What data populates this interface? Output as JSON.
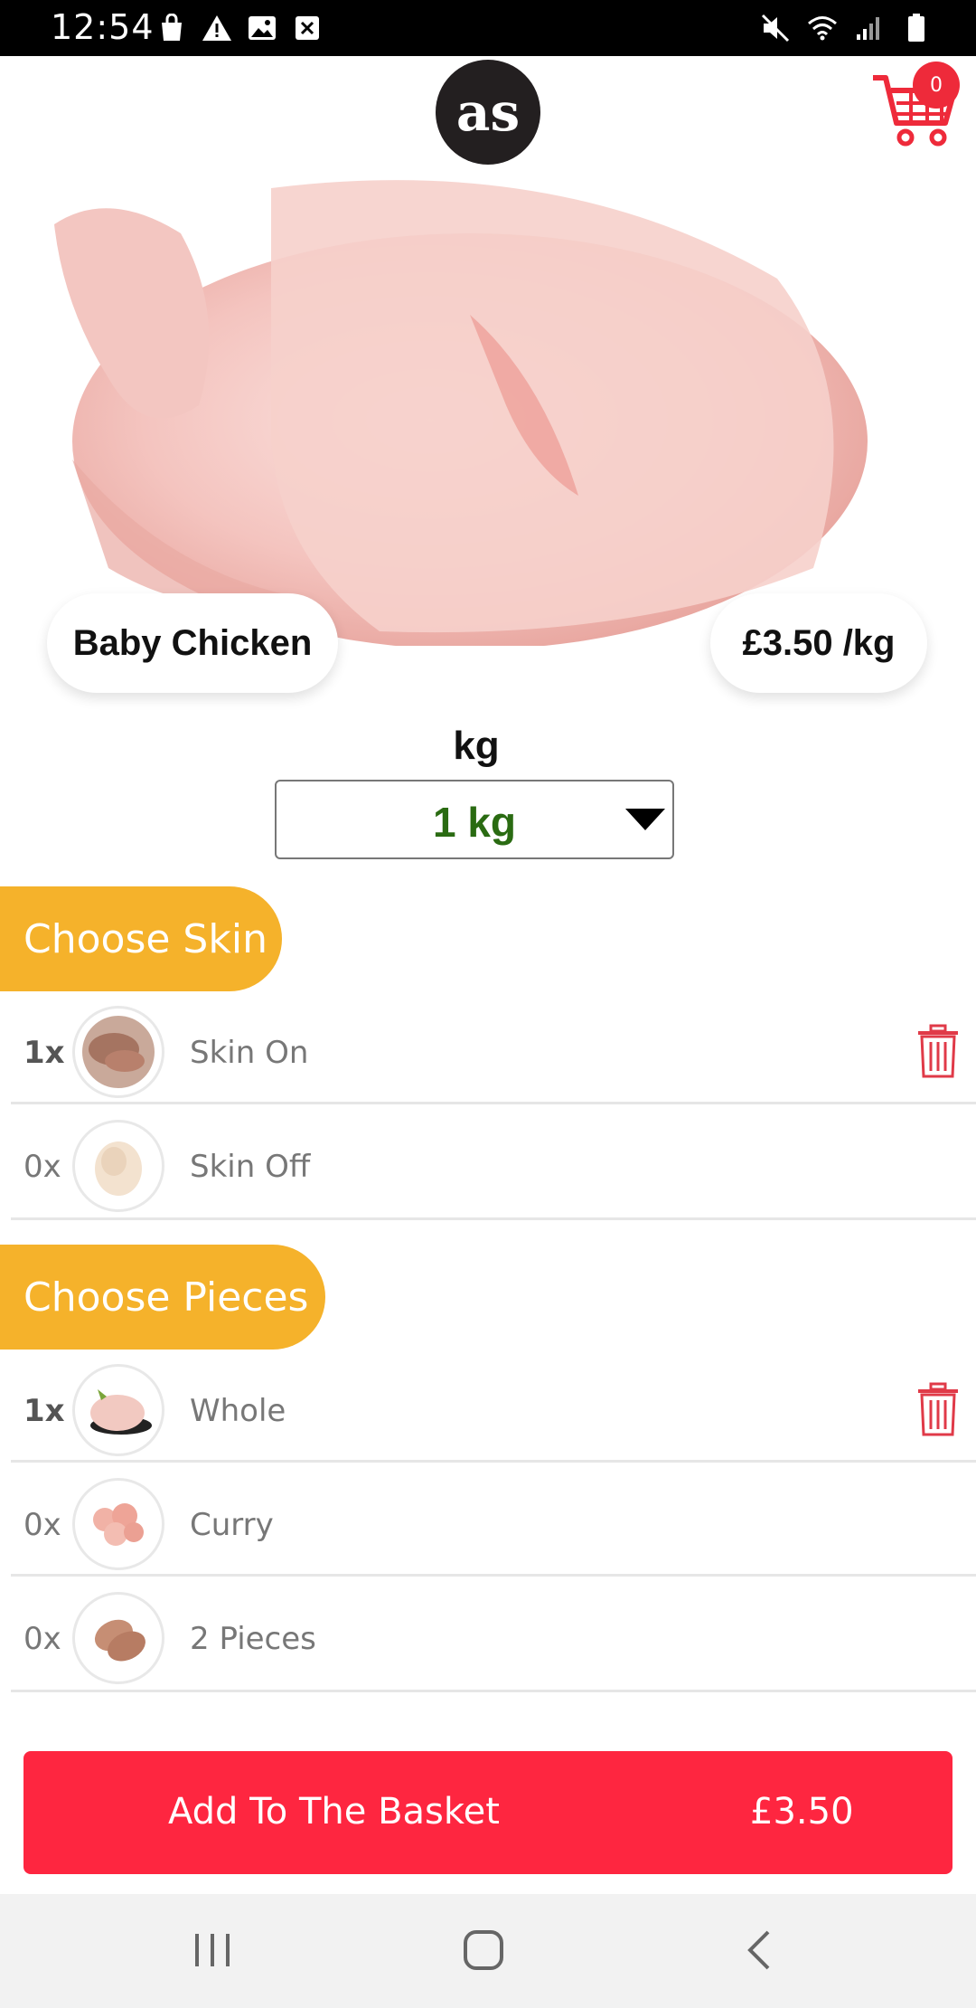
{
  "status_bar": {
    "time": "12:54",
    "left_icons": [
      "bag-icon",
      "warning-icon",
      "image-icon",
      "close-box-icon"
    ],
    "right_icons": [
      "mute-icon",
      "wifi-icon",
      "signal-icon",
      "battery-icon"
    ]
  },
  "header": {
    "logo_text": "as",
    "cart_count": "0"
  },
  "product": {
    "name": "Baby Chicken",
    "price": "£3.50 /kg"
  },
  "unit": {
    "label": "kg",
    "selected": "1 kg"
  },
  "sections": {
    "skin": {
      "title": "Choose Skin",
      "items": [
        {
          "qty": "1x",
          "label": "Skin On"
        },
        {
          "qty": "0x",
          "label": "Skin Off"
        }
      ]
    },
    "pieces": {
      "title": "Choose Pieces",
      "items": [
        {
          "qty": "1x",
          "label": "Whole"
        },
        {
          "qty": "0x",
          "label": "Curry"
        },
        {
          "qty": "0x",
          "label": "2 Pieces"
        }
      ]
    }
  },
  "basket": {
    "label": "Add To The Basket",
    "price": "£3.50"
  },
  "colors": {
    "accent_red": "#fe2640",
    "section_yellow": "#f5b22b",
    "unit_green": "#2a6b12"
  }
}
